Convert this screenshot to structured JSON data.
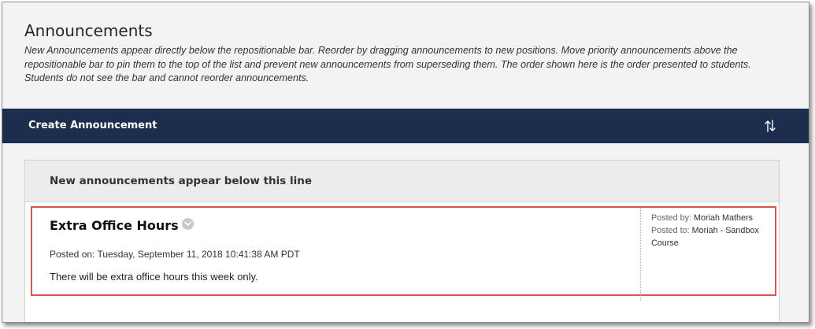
{
  "page": {
    "title": "Announcements",
    "instructions": "New Announcements appear directly below the repositionable bar. Reorder by dragging announcements to new positions. Move priority announcements above the repositionable bar to pin them to the top of the list and prevent new announcements from superseding them. The order shown here is the order presented to students. Students do not see the bar and cannot reorder announcements."
  },
  "action_bar": {
    "create_label": "Create Announcement",
    "reorder_icon": "sort-arrows-icon",
    "background": "#1c2d4d"
  },
  "list": {
    "divider_label": "New announcements appear below this line",
    "announcements": [
      {
        "title": "Extra Office Hours",
        "menu_icon": "chevron-down-icon",
        "posted_on": "Posted on: Tuesday, September 11, 2018 10:41:38 AM PDT",
        "body": "There will be extra office hours this week only.",
        "posted_by_label": "Posted by:",
        "posted_by": "Moriah Mathers",
        "posted_to_label": "Posted to:",
        "posted_to": "Moriah - Sandbox Course"
      }
    ]
  },
  "colors": {
    "highlight_border": "#d9534f",
    "page_background": "#f3f3f3"
  }
}
